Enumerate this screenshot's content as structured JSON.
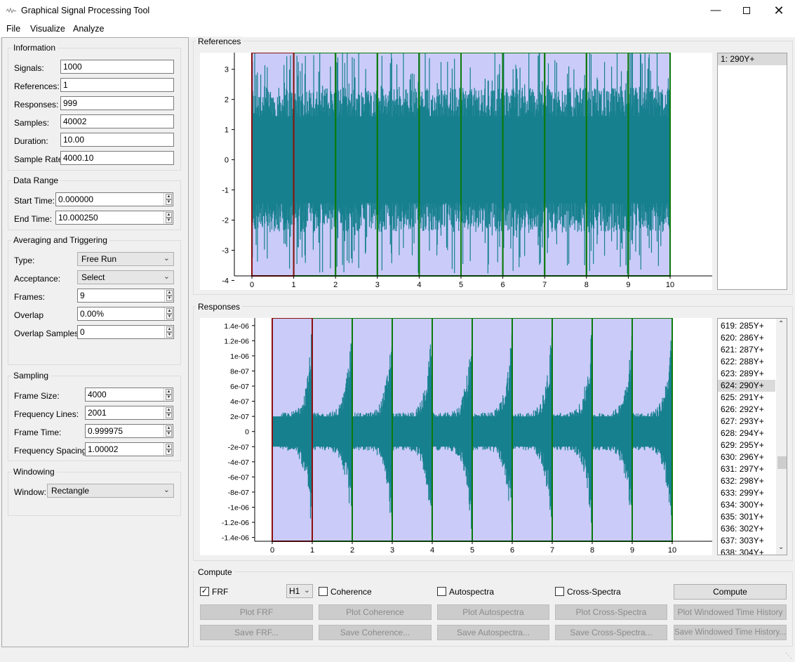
{
  "window": {
    "title": "Graphical Signal Processing Tool",
    "icon": "app-logo-icon",
    "controls": [
      "minimize-icon",
      "maximize-icon",
      "close-icon"
    ]
  },
  "menu": [
    "File",
    "Visualize",
    "Analyze"
  ],
  "information": {
    "title": "Information",
    "rows": [
      {
        "label": "Signals:",
        "value": "1000"
      },
      {
        "label": "References:",
        "value": "1"
      },
      {
        "label": "Responses:",
        "value": "999"
      },
      {
        "label": "Samples:",
        "value": "40002"
      },
      {
        "label": "Duration:",
        "value": "10.00"
      },
      {
        "label": "Sample Rate",
        "value": "4000.10"
      }
    ]
  },
  "data_range": {
    "title": "Data Range",
    "start_label": "Start Time:",
    "start_value": "0.000000",
    "end_label": "End Time:",
    "end_value": "10.000250"
  },
  "averaging": {
    "title": "Averaging and Triggering",
    "type_label": "Type:",
    "type_value": "Free Run",
    "acceptance_label": "Acceptance:",
    "acceptance_value": "Select",
    "frames_label": "Frames:",
    "frames_value": "9",
    "overlap_label": "Overlap",
    "overlap_value": "0.00%",
    "overlap_samples_label": "Overlap Samples:",
    "overlap_samples_value": "0"
  },
  "sampling": {
    "title": "Sampling",
    "rows": [
      {
        "label": "Frame Size:",
        "value": "4000"
      },
      {
        "label": "Frequency Lines:",
        "value": "2001"
      },
      {
        "label": "Frame Time:",
        "value": "0.999975"
      },
      {
        "label": "Frequency Spacing:",
        "value": "1.00002"
      }
    ]
  },
  "windowing": {
    "title": "Windowing",
    "window_label": "Window:",
    "window_value": "Rectangle"
  },
  "references": {
    "title": "References",
    "list": [
      {
        "text": "1: 290Y+",
        "selected": true
      }
    ]
  },
  "responses": {
    "title": "Responses",
    "list": [
      {
        "text": "619: 285Y+"
      },
      {
        "text": "620: 286Y+"
      },
      {
        "text": "621: 287Y+"
      },
      {
        "text": "622: 288Y+"
      },
      {
        "text": "623: 289Y+"
      },
      {
        "text": "624: 290Y+",
        "selected": true
      },
      {
        "text": "625: 291Y+"
      },
      {
        "text": "626: 292Y+"
      },
      {
        "text": "627: 293Y+"
      },
      {
        "text": "628: 294Y+"
      },
      {
        "text": "629: 295Y+"
      },
      {
        "text": "630: 296Y+"
      },
      {
        "text": "631: 297Y+"
      },
      {
        "text": "632: 298Y+"
      },
      {
        "text": "633: 299Y+"
      },
      {
        "text": "634: 300Y+"
      },
      {
        "text": "635: 301Y+"
      },
      {
        "text": "636: 302Y+"
      },
      {
        "text": "637: 303Y+"
      },
      {
        "text": "638: 304Y+"
      }
    ]
  },
  "compute": {
    "title": "Compute",
    "frf_label": "FRF",
    "frf_checked": true,
    "h_value": "H1",
    "coherence_label": "Coherence",
    "coherence_checked": false,
    "autospectra_label": "Autospectra",
    "autospectra_checked": false,
    "cross_label": "Cross-Spectra",
    "cross_checked": false,
    "compute_button": "Compute",
    "plot_buttons": [
      "Plot FRF",
      "Plot Coherence",
      "Plot Autospectra",
      "Plot Cross-Spectra",
      "Plot Windowed Time History"
    ],
    "save_buttons": [
      "Save FRF...",
      "Save Coherence...",
      "Save Autospectra...",
      "Save Cross-Spectra...",
      "Save Windowed Time History..."
    ]
  },
  "colors": {
    "signal": "#17808f",
    "window_fill": "#cacbf9",
    "active_frame": "#8b1010",
    "frame": "#0b7a0b"
  },
  "chart_data": [
    {
      "type": "line",
      "name": "references-plot",
      "x_range": [
        0,
        10
      ],
      "ylim": [
        -3.85,
        3.55
      ],
      "x_ticks": [
        "0",
        "1",
        "2",
        "3",
        "4",
        "5",
        "6",
        "7",
        "8",
        "9",
        "10"
      ],
      "y_ticks": [
        {
          "v": 3,
          "t": "3"
        },
        {
          "v": 2,
          "t": "2"
        },
        {
          "v": 1,
          "t": "1"
        },
        {
          "v": 0,
          "t": "0"
        },
        {
          "v": -1,
          "t": "-1"
        },
        {
          "v": -2,
          "t": "-2"
        },
        {
          "v": -3,
          "t": "-3"
        },
        {
          "v": -4,
          "t": "-4"
        }
      ],
      "envelope": {
        "style": "stationary",
        "mean_amplitude": 2.4,
        "peak_amplitude": 3.8
      },
      "frames": [
        [
          0,
          1
        ],
        [
          1,
          2
        ],
        [
          2,
          3
        ],
        [
          3,
          4
        ],
        [
          4,
          5
        ],
        [
          5,
          6
        ],
        [
          6,
          7
        ],
        [
          7,
          8
        ],
        [
          8,
          9
        ],
        [
          9,
          10
        ]
      ],
      "active_frame": 0
    },
    {
      "type": "line",
      "name": "responses-plot",
      "x_range": [
        0,
        10
      ],
      "ylim": [
        -1.45e-06,
        1.5e-06
      ],
      "x_ticks": [
        "0",
        "1",
        "2",
        "3",
        "4",
        "5",
        "6",
        "7",
        "8",
        "9",
        "10"
      ],
      "y_ticks": [
        {
          "v": 1.4e-06,
          "t": "1.4e-06"
        },
        {
          "v": 1.2e-06,
          "t": "1.2e-06"
        },
        {
          "v": 1e-06,
          "t": "1e-06"
        },
        {
          "v": 8e-07,
          "t": "8e-07"
        },
        {
          "v": 6e-07,
          "t": "6e-07"
        },
        {
          "v": 4e-07,
          "t": "4e-07"
        },
        {
          "v": 2e-07,
          "t": "2e-07"
        },
        {
          "v": 0,
          "t": "0"
        },
        {
          "v": -2e-07,
          "t": "-2e-07"
        },
        {
          "v": -4e-07,
          "t": "-4e-07"
        },
        {
          "v": -6e-07,
          "t": "-6e-07"
        },
        {
          "v": -8e-07,
          "t": "-8e-07"
        },
        {
          "v": -1e-06,
          "t": "-1e-06"
        },
        {
          "v": -1.2e-06,
          "t": "-1.2e-06"
        },
        {
          "v": -1.4e-06,
          "t": "-1.4e-06"
        }
      ],
      "envelope": {
        "style": "periodic-bursts",
        "period": 1,
        "low_amplitude": 2.5e-07,
        "peak_amplitude": 1.45e-06
      },
      "frames": [
        [
          0,
          1
        ],
        [
          1,
          2
        ],
        [
          2,
          3
        ],
        [
          3,
          4
        ],
        [
          4,
          5
        ],
        [
          5,
          6
        ],
        [
          6,
          7
        ],
        [
          7,
          8
        ],
        [
          8,
          9
        ],
        [
          9,
          10
        ]
      ],
      "active_frame": 0
    }
  ]
}
